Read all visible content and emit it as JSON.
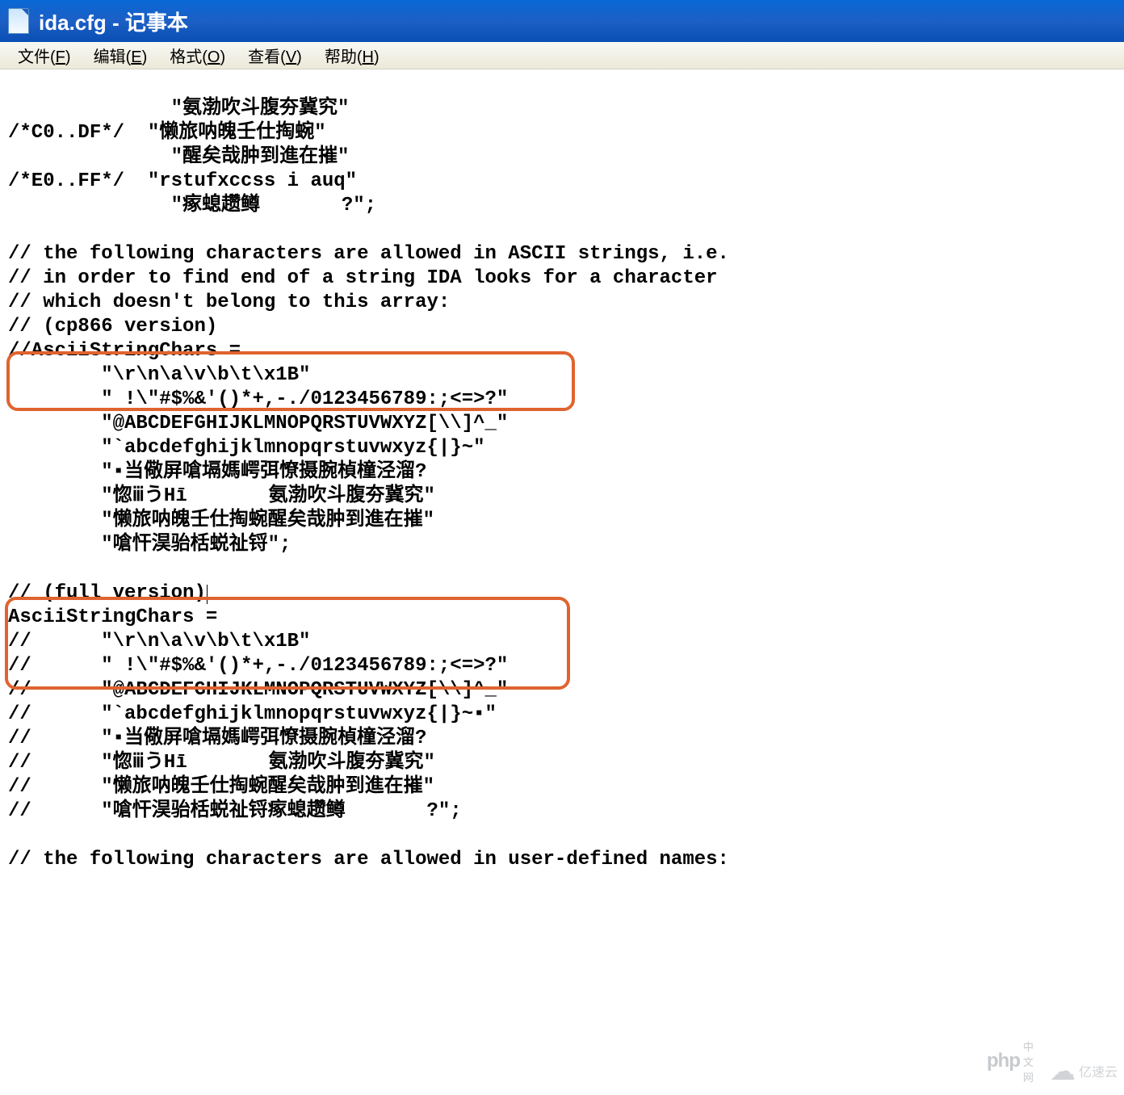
{
  "window": {
    "title": "ida.cfg - 记事本"
  },
  "menu": {
    "file": {
      "label": "文件",
      "key": "F"
    },
    "edit": {
      "label": "编辑",
      "key": "E"
    },
    "format": {
      "label": "格式",
      "key": "O"
    },
    "view": {
      "label": "查看",
      "key": "V"
    },
    "help": {
      "label": "帮助",
      "key": "H"
    }
  },
  "lines": {
    "l01": "              \"氨渤吹斗腹夯冀究\"",
    "l02": "/*C0..DF*/  \"懒旅呐魄壬仕掏蜿\"",
    "l03": "              \"醒矣哉肿到進在摧\"",
    "l04": "/*E0..FF*/  \"rstufxccss i auq\"",
    "l05": "              \"瘃螅趱鳟       ?\";",
    "l06": "",
    "l07": "// the following characters are allowed in ASCII strings, i.e.",
    "l08": "// in order to find end of a string IDA looks for a character",
    "l09": "// which doesn't belong to this array:",
    "l10": "// (cp866 version)",
    "l11": "//AsciiStringChars =",
    "l12": "        \"\\r\\n\\a\\v\\b\\t\\x1B\"",
    "l13": "        \" !\\\"#$%&'()*+,-./0123456789:;<=>?\"",
    "l14": "        \"@ABCDEFGHIJKLMNOPQRSTUVWXYZ[\\\\]^_\"",
    "l15": "        \"`abcdefghijklmnopqrstuvwxyz{|}~\"",
    "l16": "        \"▪当儆屏嗆塥媽崿弭憭摄腕楨橦泾溜?",
    "l17": "        \"惚ⅲうНī       氨渤吹斗腹夯冀究\"",
    "l18": "        \"懒旅呐魄壬仕掏蜿醒矣哉肿到進在摧\"",
    "l19": "        \"嗆忓淏骀栝蜕祉锊\";",
    "l20": "",
    "l21_pre": "// (full version)",
    "l22": "AsciiStringChars =",
    "l23": "//      \"\\r\\n\\a\\v\\b\\t\\x1B\"",
    "l24": "//      \" !\\\"#$%&'()*+,-./0123456789:;<=>?\"",
    "l25": "//      \"@ABCDEFGHIJKLMNOPQRSTUVWXYZ[\\\\]^_\"",
    "l26": "//      \"`abcdefghijklmnopqrstuvwxyz{|}~▪\"",
    "l27": "//      \"▪当儆屏嗆塥媽崿弭憭摄腕楨橦泾溜?",
    "l28": "//      \"惚ⅲうНī       氨渤吹斗腹夯冀究\"",
    "l29": "//      \"懒旅呐魄壬仕掏蜿醒矣哉肿到進在摧\"",
    "l30": "//      \"嗆忓淏骀栝蜕祉锊瘃螅趱鳟       ?\";",
    "l31": "",
    "l32": "// the following characters are allowed in user-defined names:"
  },
  "watermarks": {
    "wm1_logo": "php",
    "wm1_text": "中文网",
    "wm2_logo": "☁",
    "wm2_text": "亿速云"
  }
}
